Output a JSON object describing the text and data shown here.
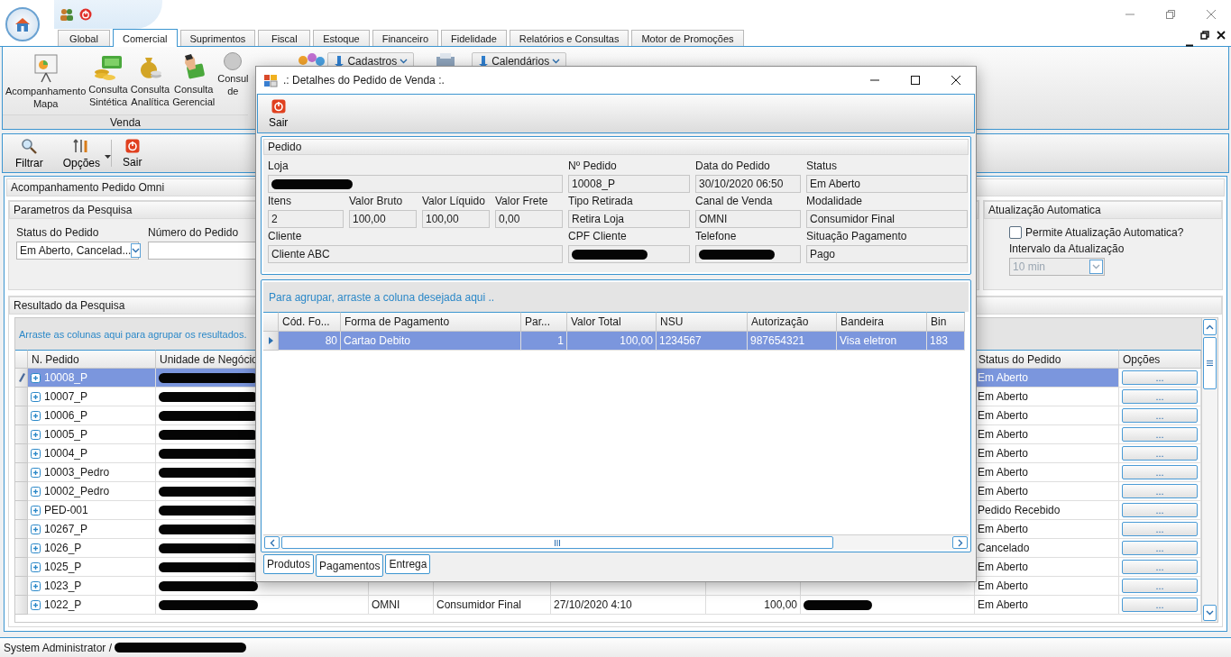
{
  "tabs": [
    {
      "label": "Global",
      "selected": false
    },
    {
      "label": "Comercial",
      "selected": true
    },
    {
      "label": "Suprimentos",
      "selected": false
    },
    {
      "label": "Fiscal",
      "selected": false
    },
    {
      "label": "Estoque",
      "selected": false
    },
    {
      "label": "Financeiro",
      "selected": false
    },
    {
      "label": "Fidelidade",
      "selected": false
    },
    {
      "label": "Relatórios e Consultas",
      "selected": false
    },
    {
      "label": "Motor de Promoções",
      "selected": false
    }
  ],
  "ribbon": {
    "items": [
      {
        "lines": [
          "Acompanhamento",
          "Mapa"
        ],
        "kind": "chart"
      },
      {
        "lines": [
          "Consulta",
          "Sintética"
        ],
        "kind": "money"
      },
      {
        "lines": [
          "Consulta",
          "Analítica"
        ],
        "kind": "bag"
      },
      {
        "lines": [
          "Consulta",
          "Gerencial"
        ],
        "kind": "hand"
      },
      {
        "lines": [
          "Consul",
          "de"
        ],
        "kind": "globe"
      }
    ],
    "group_label": "Venda",
    "menus": [
      {
        "label": "Cadastros"
      },
      {
        "label": "Calendários"
      }
    ]
  },
  "toolbar": [
    {
      "label": "Filtrar",
      "kind": "search",
      "dropdown": false
    },
    {
      "label": "Opções",
      "kind": "tools",
      "dropdown": true
    },
    {
      "label": "Sair",
      "kind": "exit",
      "dropdown": false
    }
  ],
  "panel_title": "Acompanhamento Pedido Omni",
  "search_params": {
    "title": "Parametros da Pesquisa",
    "status_label": "Status do Pedido",
    "status_value": "Em Aberto, Cancelad...",
    "number_label": "Número do Pedido"
  },
  "auto_update": {
    "title": "Atualização Automatica",
    "checkbox_label": "Permite Atualização Automatica?",
    "checked": false,
    "interval_label": "Intervalo da Atualização",
    "interval_value": "10 min",
    "disabled": true
  },
  "results": {
    "title": "Resultado da Pesquisa",
    "group_hint": "Arraste as colunas aqui para agrupar os resultados.",
    "columns": {
      "column_1": "N. Pedido",
      "column_2": "Unidade de Negócio",
      "column_8": "Status do Pedido",
      "column_9": "Opções"
    },
    "rows": [
      {
        "pedido": "10008_P",
        "expanded": false,
        "unidade_redacted": true,
        "status": "Em Aberto",
        "options": "...",
        "selected": true
      },
      {
        "pedido": "10007_P",
        "expanded": false,
        "unidade_redacted": true,
        "status": "Em Aberto",
        "options": "...",
        "selected": false
      },
      {
        "pedido": "10006_P",
        "expanded": false,
        "unidade_redacted": true,
        "status": "Em Aberto",
        "options": "...",
        "selected": false
      },
      {
        "pedido": "10005_P",
        "expanded": false,
        "unidade_redacted": true,
        "status": "Em Aberto",
        "options": "...",
        "selected": false
      },
      {
        "pedido": "10004_P",
        "expanded": false,
        "unidade_redacted": true,
        "status": "Em Aberto",
        "options": "...",
        "selected": false
      },
      {
        "pedido": "10003_Pedro",
        "expanded": false,
        "unidade_redacted": true,
        "status": "Em Aberto",
        "options": "...",
        "selected": false
      },
      {
        "pedido": "10002_Pedro",
        "expanded": false,
        "unidade_redacted": true,
        "status": "Em Aberto",
        "options": "...",
        "selected": false
      },
      {
        "pedido": "PED-001",
        "expanded": false,
        "unidade_redacted": true,
        "status": "Pedido Recebido",
        "options": "...",
        "selected": false
      },
      {
        "pedido": "10267_P",
        "expanded": false,
        "unidade_redacted": true,
        "status": "Em Aberto",
        "options": "...",
        "selected": false
      },
      {
        "pedido": "1026_P",
        "expanded": false,
        "unidade_redacted": true,
        "status": "Cancelado",
        "options": "...",
        "selected": false
      },
      {
        "pedido": "1025_P",
        "expanded": false,
        "unidade_redacted": true,
        "status": "Em Aberto",
        "options": "...",
        "selected": false
      },
      {
        "pedido": "1023_P",
        "expanded": false,
        "unidade_redacted": true,
        "status": "Em Aberto",
        "options": "...",
        "selected": false
      },
      {
        "pedido": "1022_P",
        "expanded": false,
        "unidade_redacted": true,
        "column_3": "OMNI",
        "column_4": "Consumidor Final",
        "column_5": "27/10/2020 4:10",
        "column_6": "100,00",
        "column_7_redacted": true,
        "status": "Em Aberto",
        "options": "...",
        "selected": false
      }
    ]
  },
  "status_bar": {
    "user": "System Administrator /",
    "redacted": true
  },
  "dialog": {
    "title": ".: Detalhes do Pedido de Venda :.",
    "toolbar": [
      {
        "label": "Sair",
        "kind": "exit"
      }
    ],
    "group_title": "Pedido",
    "fields": [
      {
        "label": "Loja",
        "kind": "wide",
        "redacted": true
      },
      {
        "label": "Nº Pedido",
        "kind": "normal",
        "value": "10008_P"
      },
      {
        "label": "Data do Pedido",
        "kind": "normal",
        "value": "30/10/2020 06:50"
      },
      {
        "label": "Status",
        "kind": "normal",
        "value": "Em Aberto"
      },
      {
        "label": "Itens",
        "kind": "normal",
        "value": "2"
      },
      {
        "label": "Valor Bruto",
        "kind": "normal",
        "value": "100,00"
      },
      {
        "label": "Valor Líquido",
        "kind": "normal",
        "value": "100,00"
      },
      {
        "label": "Valor Frete",
        "kind": "normal",
        "value": "0,00"
      },
      {
        "label": "Tipo Retirada",
        "kind": "normal",
        "value": "Retira Loja"
      },
      {
        "label": "Canal de Venda",
        "kind": "normal",
        "value": "OMNI"
      },
      {
        "label": "Modalidade",
        "kind": "normal",
        "value": "Consumidor Final"
      },
      {
        "label": "Cliente",
        "kind": "wide",
        "value": "Cliente ABC"
      },
      {
        "label": "CPF Cliente",
        "kind": "normal",
        "redacted": true
      },
      {
        "label": "Telefone",
        "kind": "normal",
        "redacted": true
      },
      {
        "label": "Situação Pagamento",
        "kind": "normal",
        "value": "Pago"
      }
    ],
    "grid_hint": "Para agrupar, arraste a coluna desejada aqui ..",
    "columns": [
      "Cód. Fo...",
      "Forma de Pagamento",
      "Par...",
      "Valor Total",
      "NSU",
      "Autorização",
      "Bandeira",
      "Bin"
    ],
    "rows": [
      {
        "cells": [
          "80",
          "Cartao Debito",
          "1",
          "100,00",
          "1234567",
          "987654321",
          "Visa eletron",
          "183"
        ],
        "selected": true
      }
    ],
    "tabs": [
      {
        "label": "Produtos",
        "selected": false
      },
      {
        "label": "Pagamentos",
        "selected": true
      },
      {
        "label": "Entrega",
        "selected": false
      }
    ]
  }
}
